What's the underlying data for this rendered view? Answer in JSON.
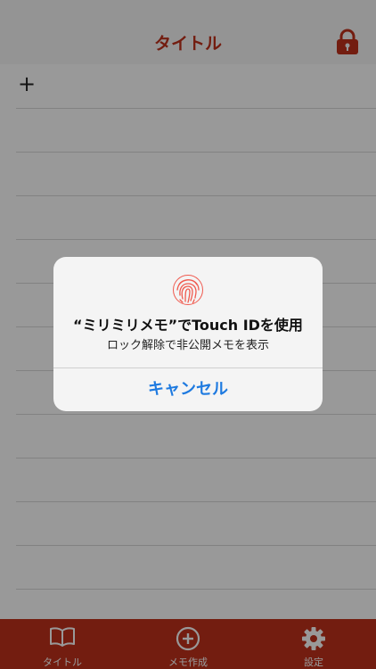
{
  "navbar": {
    "title": "タイトル",
    "lock_icon": "lock-icon",
    "accent": "#c0311c"
  },
  "list": {
    "add_symbol": "+",
    "row_count": 13
  },
  "tabbar": {
    "background": "#c0311c",
    "tabs": [
      {
        "label": "タイトル",
        "icon": "book-icon"
      },
      {
        "label": "メモ作成",
        "icon": "plus-circle-icon"
      },
      {
        "label": "設定",
        "icon": "gear-icon"
      }
    ]
  },
  "alert": {
    "icon": "fingerprint-icon",
    "title": "“ミリミリメモ”でTouch IDを使用",
    "message": "ロック解除で非公開メモを表示",
    "cancel_label": "キャンセル",
    "cancel_color": "#1e7ae0"
  }
}
